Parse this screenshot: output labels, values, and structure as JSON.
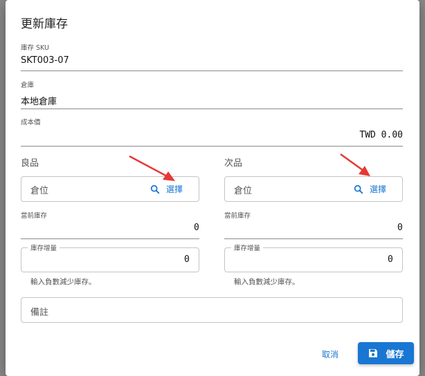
{
  "dialog": {
    "title": "更新庫存",
    "sku": {
      "label": "庫存 SKU",
      "value": "SKT003-07"
    },
    "warehouse": {
      "label": "倉庫",
      "value": "本地倉庫"
    },
    "cost": {
      "label": "成本價",
      "value": "TWD 0.00"
    },
    "good": {
      "section": "良品",
      "location_placeholder": "倉位",
      "select_label": "選擇",
      "current_label": "當前庫存",
      "current_value": "0",
      "delta_label": "庫存增量",
      "delta_value": "0",
      "helper": "輸入負數減少庫存。"
    },
    "defective": {
      "section": "次品",
      "location_placeholder": "倉位",
      "select_label": "選擇",
      "current_label": "當前庫存",
      "current_value": "0",
      "delta_label": "庫存增量",
      "delta_value": "0",
      "helper": "輸入負數減少庫存。"
    },
    "notes_placeholder": "備註",
    "cancel_label": "取消",
    "save_label": "儲存"
  },
  "colors": {
    "primary": "#1976d2",
    "annotation_arrow": "#e53935"
  }
}
